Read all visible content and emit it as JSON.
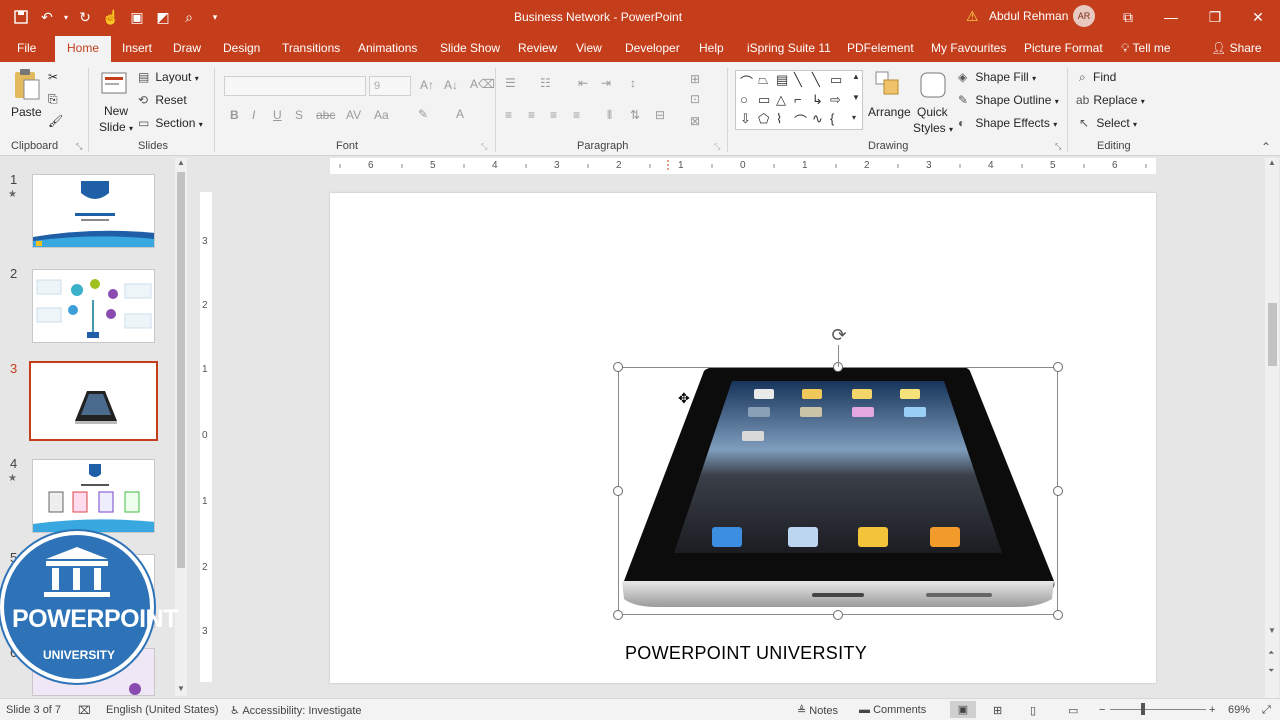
{
  "titlebar": {
    "doc_title": "Business Network  -  PowerPoint",
    "user_name": "Abdul Rehman",
    "avatar_initials": "AR"
  },
  "tabs": [
    "File",
    "Home",
    "Insert",
    "Draw",
    "Design",
    "Transitions",
    "Animations",
    "Slide Show",
    "Review",
    "View",
    "Developer",
    "Help",
    "iSpring Suite 11",
    "PDFelement",
    "My Favourites",
    "Picture Format"
  ],
  "tellme": "Tell me",
  "share": "Share",
  "ribbon": {
    "clipboard": {
      "paste": "Paste",
      "label": "Clipboard"
    },
    "slides": {
      "new_slide_1": "New",
      "new_slide_2": "Slide",
      "layout": "Layout",
      "reset": "Reset",
      "section": "Section",
      "label": "Slides"
    },
    "font": {
      "size": "9",
      "label": "Font"
    },
    "paragraph": {
      "label": "Paragraph"
    },
    "drawing": {
      "arrange": "Arrange",
      "quick_styles_1": "Quick",
      "quick_styles_2": "Styles",
      "shape_fill": "Shape Fill",
      "shape_outline": "Shape Outline",
      "shape_effects": "Shape Effects",
      "label": "Drawing"
    },
    "editing": {
      "find": "Find",
      "replace": "Replace",
      "select": "Select",
      "label": "Editing"
    }
  },
  "slides_panel": {
    "numbers": [
      "1",
      "2",
      "3",
      "4",
      "5",
      "6"
    ],
    "current": 3
  },
  "badge": {
    "title": "POWERPOINT",
    "subtitle": "UNIVERSITY"
  },
  "hruler_ticks": [
    "6",
    "5",
    "4",
    "3",
    "2",
    "1",
    "0",
    "1",
    "2",
    "3",
    "4",
    "5",
    "6"
  ],
  "vruler_ticks": [
    "3",
    "2",
    "1",
    "0",
    "1",
    "2",
    "3"
  ],
  "slide": {
    "caption": "POWERPOINT UNIVERSITY"
  },
  "statusbar": {
    "slide_info": "Slide 3 of 7",
    "language": "English (United States)",
    "accessibility": "Accessibility: Investigate",
    "notes": "Notes",
    "comments": "Comments",
    "zoom": "69%"
  },
  "colors": {
    "accent": "#c43e1c",
    "badge": "#2e73b8"
  }
}
